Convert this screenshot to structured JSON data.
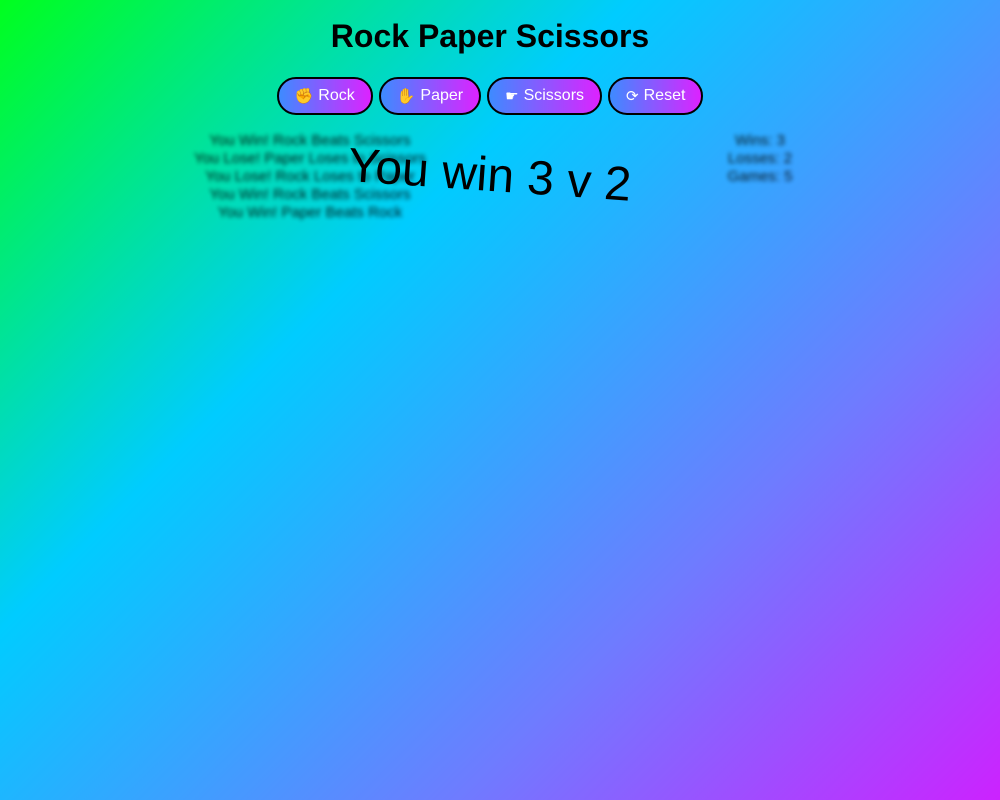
{
  "app": {
    "title": "Rock Paper Scissors"
  },
  "controls": {
    "rock": {
      "label": "Rock",
      "icon": "hand-rock-icon"
    },
    "paper": {
      "label": "Paper",
      "icon": "hand-paper-icon"
    },
    "scissors": {
      "label": "Scissors",
      "icon": "hand-scissors-icon"
    },
    "reset": {
      "label": "Reset",
      "icon": "refresh-icon"
    }
  },
  "history": [
    "You Win! Rock Beats Scissors",
    "You Lose! Paper Loses to Scissors",
    "You Lose! Rock Loses to Paper",
    "You Win! Rock Beats Scissors",
    "You Win! Paper Beats Rock"
  ],
  "stats": {
    "wins": "Wins: 3",
    "losses": "Losses: 2",
    "games": "Games: 5"
  },
  "result": {
    "text": "You win 3 v 2"
  },
  "colors": {
    "button_gradient_start": "#3d8bff",
    "button_gradient_end": "#dd22ff",
    "background_green": "#00ff1e",
    "background_cyan": "#00ccff",
    "background_magenta": "#cc22ff"
  }
}
